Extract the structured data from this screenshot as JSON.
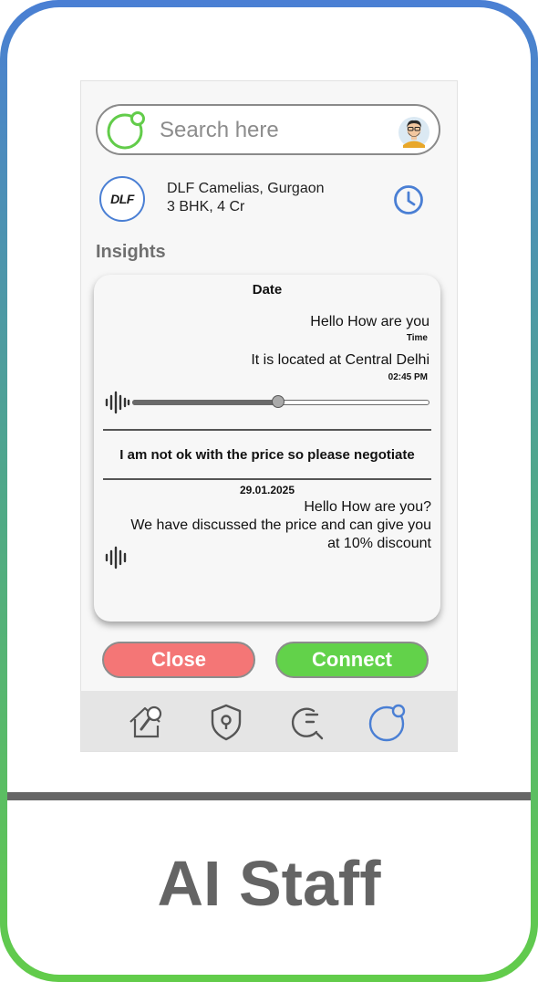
{
  "search": {
    "placeholder": "Search here"
  },
  "property": {
    "logo_text": "DLF",
    "name": "DLF Camelias, Gurgaon",
    "details": "3 BHK, 4 Cr"
  },
  "insights": {
    "title": "Insights",
    "header": "Date",
    "message_1": "Hello How are you",
    "time_label": "Time",
    "message_2": "It is located at Central Delhi",
    "time_2": "02:45 PM",
    "audio_progress": 0.49,
    "negotiation": "I am not ok with the price so please negotiate",
    "date_2": "29.01.2025",
    "reply_lines": [
      "Hello How are you?",
      "We have discussed the price and can give you",
      "at 10% discount"
    ]
  },
  "buttons": {
    "close": "Close",
    "connect": "Connect"
  },
  "nav": [
    "home-search-icon",
    "shield-key-icon",
    "search-menu-icon",
    "app-logo-icon"
  ],
  "footer": {
    "title": "AI Staff"
  },
  "colors": {
    "accent_blue": "#4a7fd4",
    "accent_green": "#62cc4a",
    "close_red": "#f47676",
    "connect_green": "#62d24a"
  }
}
